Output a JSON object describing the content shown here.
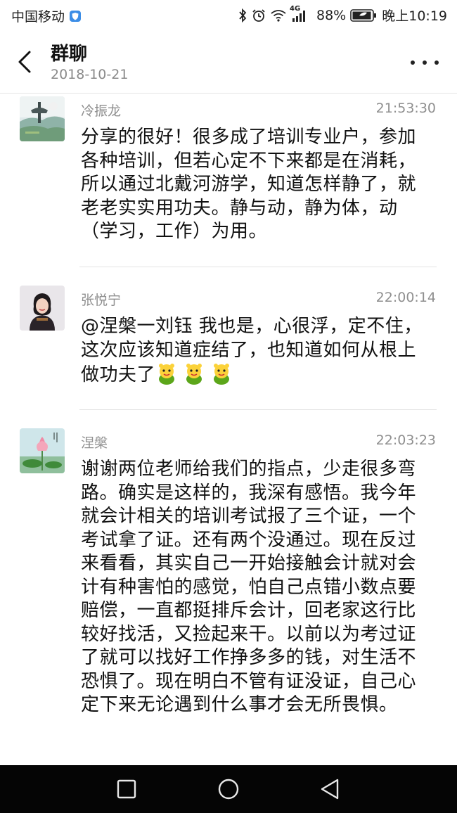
{
  "status_bar": {
    "carrier": "中国移动",
    "network": "4G",
    "battery": "88%",
    "time": "晚上10:19"
  },
  "header": {
    "title": "群聊",
    "date": "2018-10-21"
  },
  "messages": [
    {
      "name": "冷振龙",
      "time": "21:53:30",
      "text": "分享的很好！很多成了培训专业户，参加各种培训，但若心定不下来都是在消耗，所以通过北戴河游学，知道怎样静了，就老老实实用功夫。静与动，静为体，动（学习，工作）为用。"
    },
    {
      "name": "张悦宁",
      "time": "22:00:14",
      "text": "@涅槃一刘钰 我也是，心很浮，定不住，这次应该知道症结了，也知道如何从根上做功夫了"
    },
    {
      "name": "涅槃",
      "time": "22:03:23",
      "text": "谢谢两位老师给我们的指点，少走很多弯路。确实是这样的，我深有感悟。我今年就会计相关的培训考试报了三个证，一个考试拿了证。还有两个没通过。现在反过来看看，其实自己一开始接触会计就对会计有种害怕的感觉，怕自己点错小数点要赔偿，一直都挺排斥会计，回老家这行比较好找活，又捡起来干。以前以为考过证了就可以找好工作挣多多的钱，对生活不恐惧了。现在明白不管有证没证，自己心定下来无论遇到什么事才会无所畏惧。"
    }
  ],
  "icons": {
    "back": "back-arrow-icon",
    "more": "more-options-icon",
    "emoji": "green-bear-emoji",
    "nav": [
      "recent-apps-icon",
      "home-icon",
      "back-triangle-icon"
    ]
  }
}
